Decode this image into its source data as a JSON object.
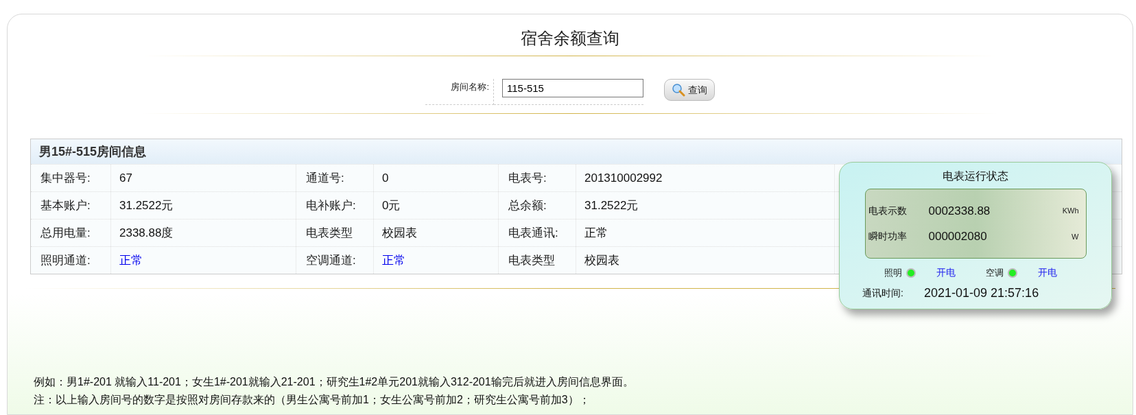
{
  "title": "宿舍余额查询",
  "search": {
    "label": "房间名称:",
    "value": "115-515",
    "button": "查询"
  },
  "room": {
    "heading": "男15#-515房间信息",
    "rows": [
      [
        {
          "label": "集中器号:",
          "value": "67",
          "kind": "text"
        },
        {
          "label": "通道号:",
          "value": "0",
          "kind": "text"
        },
        {
          "label": "电表号:",
          "value": "201310002992",
          "kind": "text"
        }
      ],
      [
        {
          "label": "基本账户:",
          "value": "31.2522元",
          "kind": "text"
        },
        {
          "label": "电补账户:",
          "value": "0元",
          "kind": "text"
        },
        {
          "label": "总余额:",
          "value": "31.2522元",
          "kind": "text"
        }
      ],
      [
        {
          "label": "总用电量:",
          "value": "2338.88度",
          "kind": "text"
        },
        {
          "label": "电表类型",
          "value": "校园表",
          "kind": "text"
        },
        {
          "label": "电表通讯:",
          "value": "正常",
          "kind": "text"
        }
      ],
      [
        {
          "label": "照明通道:",
          "value": "正常",
          "kind": "status"
        },
        {
          "label": "空调通道:",
          "value": "正常",
          "kind": "status"
        },
        {
          "label": "电表类型",
          "value": "校园表",
          "kind": "text"
        }
      ]
    ]
  },
  "meter": {
    "title": "电表运行状态",
    "readings": [
      {
        "label": "电表示数",
        "value": "0002338.88",
        "unit": "KWh"
      },
      {
        "label": "瞬时功率",
        "value": "000002080",
        "unit": "W"
      }
    ],
    "channels": [
      {
        "label": "照明",
        "on": true,
        "state": "开电"
      },
      {
        "label": "空调",
        "on": true,
        "state": "开电"
      }
    ],
    "time_label": "通讯时间:",
    "time": "2021-01-09 21:57:16"
  },
  "notes": [
    "例如：男1#-201 就输入11-201；女生1#-201就输入21-201；研究生1#2单元201就输入312-201输完后就进入房间信息界面。",
    "注：以上输入房间号的数字是按照对房间存款来的（男生公寓号前加1；女生公寓号前加2；研究生公寓号前加3）；"
  ]
}
